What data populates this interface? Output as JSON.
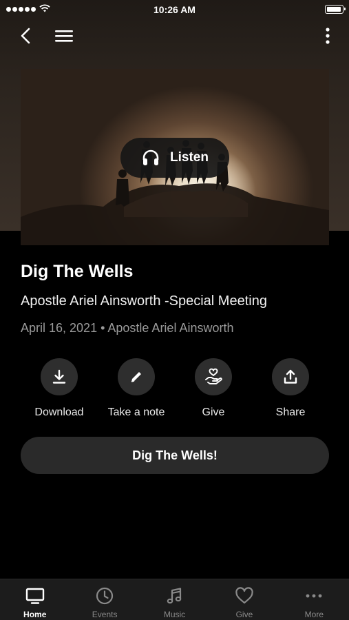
{
  "status_bar": {
    "time": "10:26 AM"
  },
  "hero": {
    "listen_label": "Listen"
  },
  "sermon": {
    "title": "Dig The Wells",
    "subtitle": "Apostle Ariel Ainsworth -Special Meeting",
    "meta": "April 16, 2021 • Apostle Ariel Ainsworth"
  },
  "actions": [
    {
      "label": "Download",
      "icon": "download-icon"
    },
    {
      "label": "Take a note",
      "icon": "pencil-icon"
    },
    {
      "label": "Give",
      "icon": "hand-heart-icon"
    },
    {
      "label": "Share",
      "icon": "share-icon"
    }
  ],
  "main_button": {
    "label": "Dig The Wells!"
  },
  "tabs": [
    {
      "label": "Home",
      "icon": "tv-icon",
      "active": true
    },
    {
      "label": "Events",
      "icon": "clock-icon",
      "active": false
    },
    {
      "label": "Music",
      "icon": "music-note-icon",
      "active": false
    },
    {
      "label": "Give",
      "icon": "heart-icon",
      "active": false
    },
    {
      "label": "More",
      "icon": "more-horizontal-icon",
      "active": false
    }
  ],
  "colors": {
    "background": "#000000",
    "button_bg": "#2a2a2a",
    "muted_text": "#9a9a9a",
    "active_tab": "#ffffff",
    "inactive_tab": "#8a8a8a"
  }
}
